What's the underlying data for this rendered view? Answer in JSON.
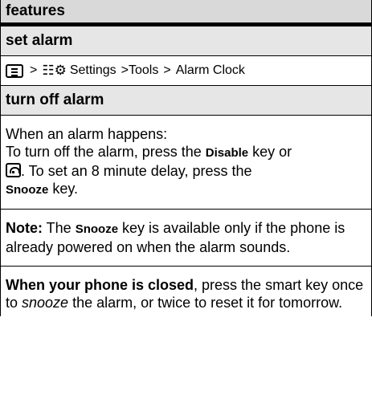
{
  "header": {
    "title": "features"
  },
  "set_alarm": {
    "title": "set alarm",
    "path_sep": ">",
    "settings_label": "Settings",
    "tools_label": ">Tools",
    "path_sep2": ">",
    "alarm_clock_label": "Alarm Clock",
    "settings_icon_glyph": "☷⚙"
  },
  "turn_off_alarm": {
    "title": "turn off alarm",
    "line1": "When an alarm happens:",
    "line2_a": "To turn off the alarm, press the ",
    "disable_key": "Disable",
    "line2_b": " key or",
    "line3_b": ". To set an 8 minute delay, press the",
    "snooze_key": "Snooze",
    "line4_b": " key."
  },
  "note": {
    "label": "Note:",
    "text_a": " The ",
    "snooze_key": "Snooze",
    "text_b": " key is available only if the phone is already powered on when the alarm sounds."
  },
  "closed": {
    "bold": "When your phone is closed",
    "text_a": ", press the smart key once to ",
    "italic": "snooze",
    "text_b": " the alarm, or twice to reset it for tomorrow."
  }
}
